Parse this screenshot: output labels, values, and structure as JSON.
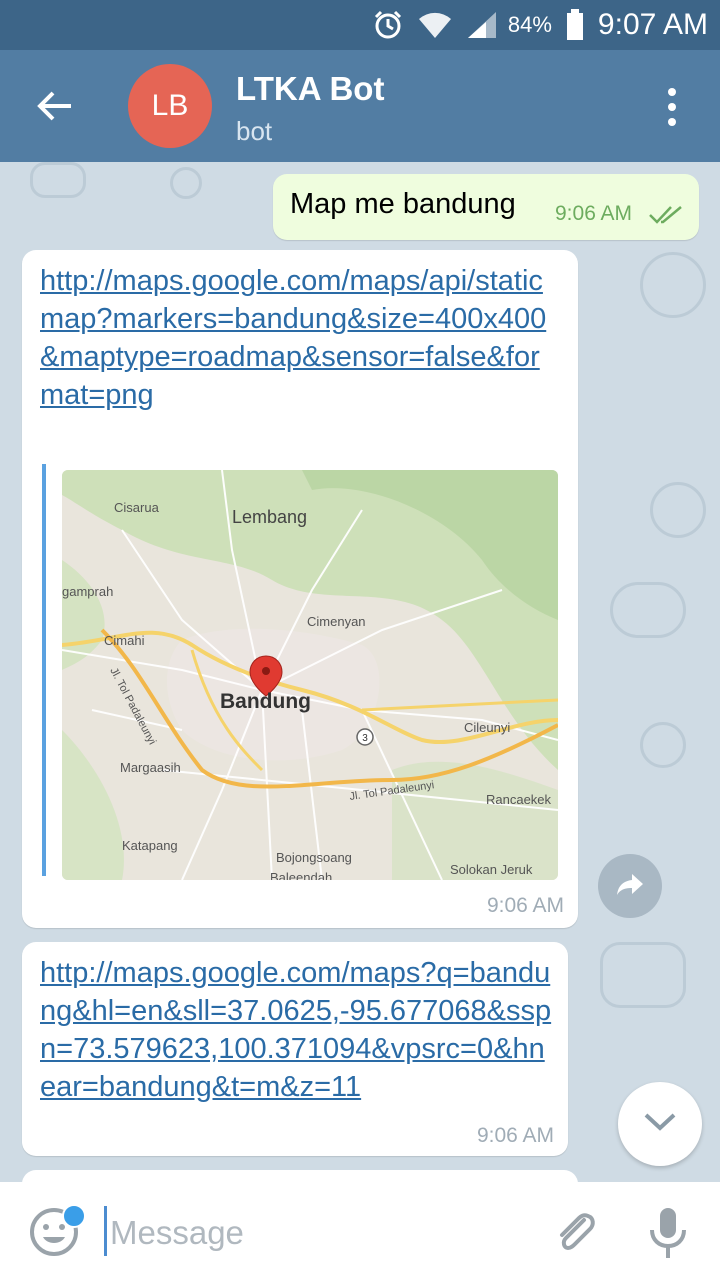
{
  "status_bar": {
    "battery_percent": "84%",
    "time": "9:07 AM",
    "icons": [
      "alarm-icon",
      "wifi-icon",
      "signal-icon",
      "battery-icon"
    ]
  },
  "header": {
    "avatar_initials": "LB",
    "avatar_color": "#e56555",
    "title": "LTKA Bot",
    "subtitle": "bot",
    "back_icon": "arrow-left-icon",
    "menu_icon": "more-vertical-icon"
  },
  "messages": [
    {
      "direction": "outgoing",
      "text": "Map me bandung",
      "time": "9:06 AM",
      "status_icon": "double-check-icon"
    },
    {
      "direction": "incoming",
      "link": "http://maps.google.com/maps/api/staticmap?markers=bandung&size=400x400&maptype=roadmap&sensor=false&format=png",
      "time": "9:06 AM",
      "map_labels": {
        "cisarua": "Cisarua",
        "lembang": "Lembang",
        "gamprah": "gamprah",
        "cimenyan": "Cimenyan",
        "cimahi": "Cimahi",
        "bandung": "Bandung",
        "jl_tol_padaleunyi_1": "Jl. Tol Padaleunyi",
        "cileunyi": "Cileunyi",
        "route_3": "3",
        "margaasih": "Margaasih",
        "jl_tol_padaleunyi_2": "Jl. Tol Padaleunyi",
        "rancaekek": "Rancaekek",
        "katapang": "Katapang",
        "bojongsoang": "Bojongsoang",
        "solokan_jeruk": "Solokan Jeruk",
        "baleendah": "Baleendah"
      }
    },
    {
      "direction": "incoming",
      "link": "http://maps.google.com/maps?q=bandung&hl=en&sll=37.0625,-95.677068&sspn=73.579623,100.371094&vpsrc=0&hnear=bandung&t=m&z=11",
      "time": "9:06 AM"
    }
  ],
  "composer": {
    "placeholder": "Message",
    "emoji_icon": "emoji-icon",
    "attach_icon": "paperclip-icon",
    "mic_icon": "microphone-icon"
  },
  "colors": {
    "header_bg": "#527da3",
    "statusbar_bg": "#3d6588",
    "outgoing_bubble": "#effdde",
    "link": "#2a6ba6"
  }
}
